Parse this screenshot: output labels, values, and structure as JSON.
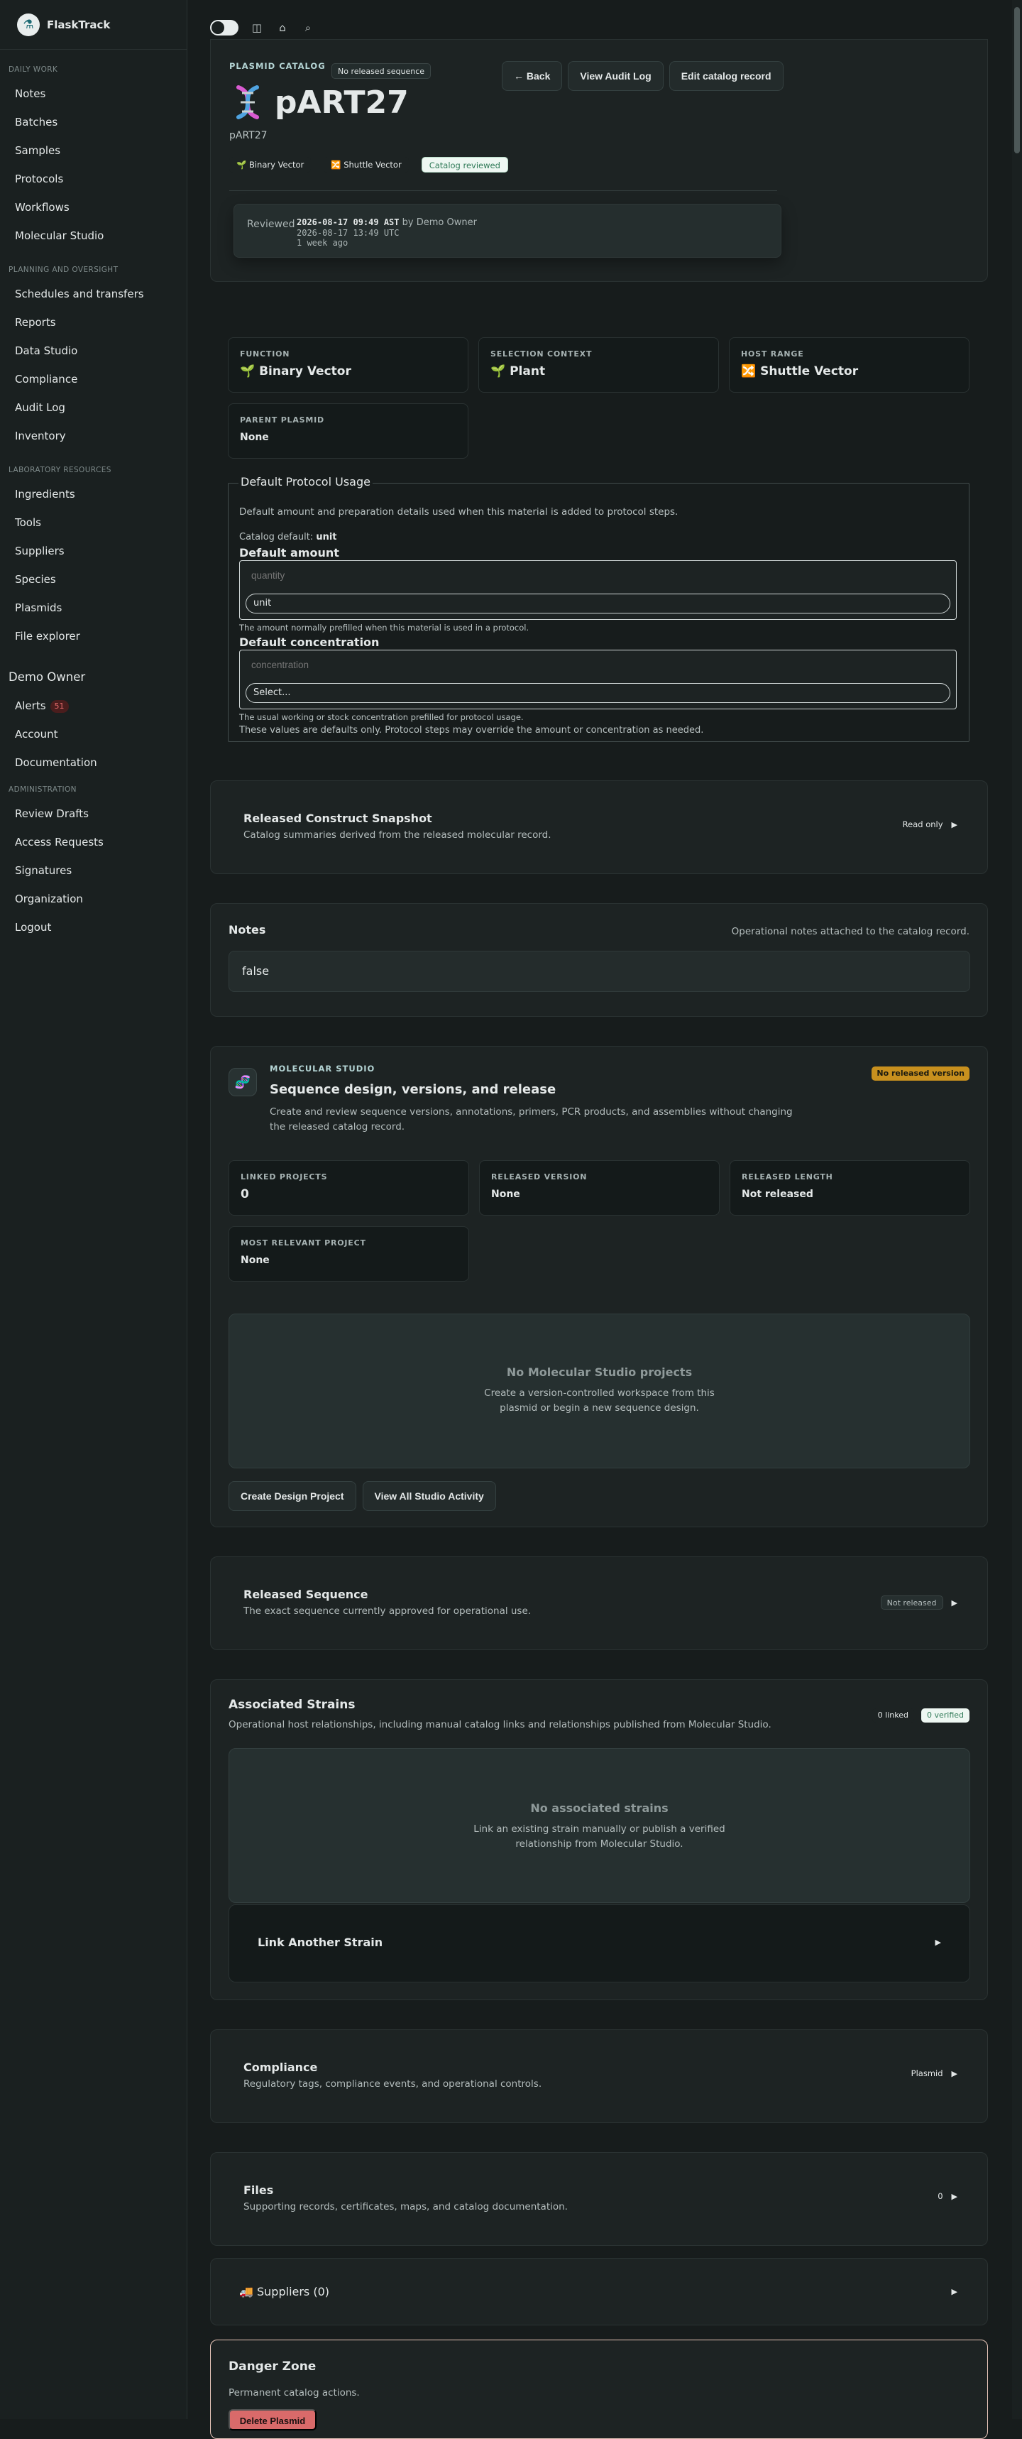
{
  "brand": {
    "name": "FlaskTrack"
  },
  "sidebar": {
    "sections": [
      {
        "label": "Daily work",
        "items": [
          "Notes",
          "Batches",
          "Samples",
          "Protocols",
          "Workflows",
          "Molecular Studio"
        ]
      },
      {
        "label": "Planning and oversight",
        "items": [
          "Schedules and transfers",
          "Reports",
          "Data Studio",
          "Compliance",
          "Audit Log",
          "Inventory"
        ]
      },
      {
        "label": "Laboratory resources",
        "items": [
          "Ingredients",
          "Tools",
          "Suppliers",
          "Species",
          "Plasmids",
          "File explorer"
        ]
      }
    ],
    "user": {
      "name": "Demo Owner",
      "alerts_label": "Alerts",
      "alerts_count": "51",
      "account": "Account",
      "docs": "Documentation"
    },
    "admin": {
      "label": "Administration",
      "items": [
        "Review Drafts",
        "Access Requests",
        "Signatures",
        "Organization",
        "Logout"
      ]
    }
  },
  "header": {
    "eyebrow": "Plasmid catalog",
    "sequence_pill": "No released sequence",
    "title": "pART27",
    "subtitle": "pART27",
    "tags": [
      "🌱 Binary Vector",
      "🔀 Shuttle Vector",
      "Catalog reviewed"
    ],
    "actions": {
      "back": "← Back",
      "audit": "View Audit Log",
      "edit": "Edit catalog record"
    },
    "review": {
      "label": "Reviewed",
      "date": "2026-08-17 09:49 AST",
      "by": " by Demo Owner",
      "utc": "2026-08-17 13:49 UTC",
      "ago": "1 week ago"
    }
  },
  "info": {
    "function": {
      "k": "Function",
      "v": "🌱 Binary Vector"
    },
    "selection": {
      "k": "Selection context",
      "v": "🌱 Plant"
    },
    "host": {
      "k": "Host range",
      "v": "🔀 Shuttle Vector"
    },
    "parent": {
      "k": "Parent plasmid",
      "v": "None"
    }
  },
  "protocol": {
    "legend": "Default Protocol Usage",
    "desc": "Default amount and preparation details used when this material is added to protocol steps.",
    "default_prefix": "Catalog default: ",
    "default_value": "unit",
    "amount_h": "Default amount",
    "amount_placeholder": "quantity",
    "amount_unit": "unit",
    "amount_hint": "The amount normally prefilled when this material is used in a protocol.",
    "conc_h": "Default concentration",
    "conc_placeholder": "concentration",
    "conc_select": "Select...",
    "conc_hint": "The usual working or stock concentration prefilled for protocol usage.",
    "foot": "These values are defaults only. Protocol steps may override the amount or concentration as needed."
  },
  "snapshot": {
    "title": "Released Construct Snapshot",
    "desc": "Catalog summaries derived from the released molecular record.",
    "right": "Read only"
  },
  "notes": {
    "title": "Notes",
    "desc": "Operational notes attached to the catalog record.",
    "value": "false"
  },
  "studio": {
    "eyebrow": "Molecular Studio",
    "title": "Sequence design, versions, and release",
    "desc": "Create and review sequence versions, annotations, primers, PCR products, and assemblies without changing the released catalog record.",
    "badge": "No released version",
    "linked": {
      "k": "Linked projects",
      "v": "0"
    },
    "released_version": {
      "k": "Released version",
      "v": "None"
    },
    "released_length": {
      "k": "Released length",
      "v": "Not released"
    },
    "relevant": {
      "k": "Most relevant project",
      "v": "None"
    },
    "empty_title": "No Molecular Studio projects",
    "empty_desc": "Create a version-controlled workspace from this plasmid or begin a new sequence design.",
    "btn_create": "Create Design Project",
    "btn_view": "View All Studio Activity"
  },
  "released_seq": {
    "title": "Released Sequence",
    "desc": "The exact sequence currently approved for operational use.",
    "right": "Not released"
  },
  "strains": {
    "title": "Associated Strains",
    "desc": "Operational host relationships, including manual catalog links and relationships published from Molecular Studio.",
    "linked": "0 linked",
    "verified": "0 verified",
    "empty_title": "No associated strains",
    "empty_desc": "Link an existing strain manually or publish a verified relationship from Molecular Studio.",
    "link_label": "Link Another Strain"
  },
  "compliance": {
    "title": "Compliance",
    "desc": "Regulatory tags, compliance events, and operational controls.",
    "right": "Plasmid"
  },
  "files": {
    "title": "Files",
    "desc": "Supporting records, certificates, maps, and catalog documentation.",
    "right": "0"
  },
  "suppliers": {
    "title": "🚚 Suppliers (0)"
  },
  "danger": {
    "title": "Danger Zone",
    "desc": "Permanent catalog actions.",
    "button": "Delete Plasmid"
  }
}
